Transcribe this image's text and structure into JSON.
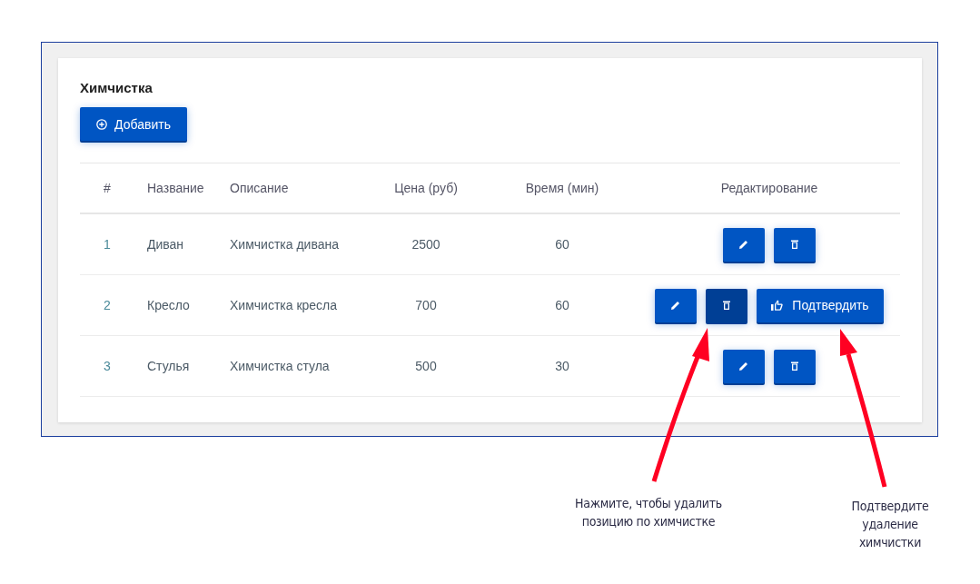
{
  "card": {
    "title": "Химчистка",
    "add_button": "Добавить"
  },
  "table": {
    "columns": [
      "#",
      "Название",
      "Описание",
      "Цена (руб)",
      "Время (мин)",
      "Редактирование"
    ],
    "rows": [
      {
        "cells": [
          "1",
          "Диван",
          "Химчистка дивана",
          "2500",
          "60"
        ],
        "deleting": false
      },
      {
        "cells": [
          "2",
          "Кресло",
          "Химчистка кресла",
          "700",
          "60"
        ],
        "deleting": true,
        "confirm_button": "Подтвердить"
      },
      {
        "cells": [
          "3",
          "Стулья",
          "Химчистка стула",
          "500",
          "30"
        ],
        "deleting": false
      }
    ]
  },
  "annotations": [
    {
      "text": "Нажмите, чтобы удалить позицию по химчистке"
    },
    {
      "text": "Подтвердите удаление химчистки"
    }
  ]
}
